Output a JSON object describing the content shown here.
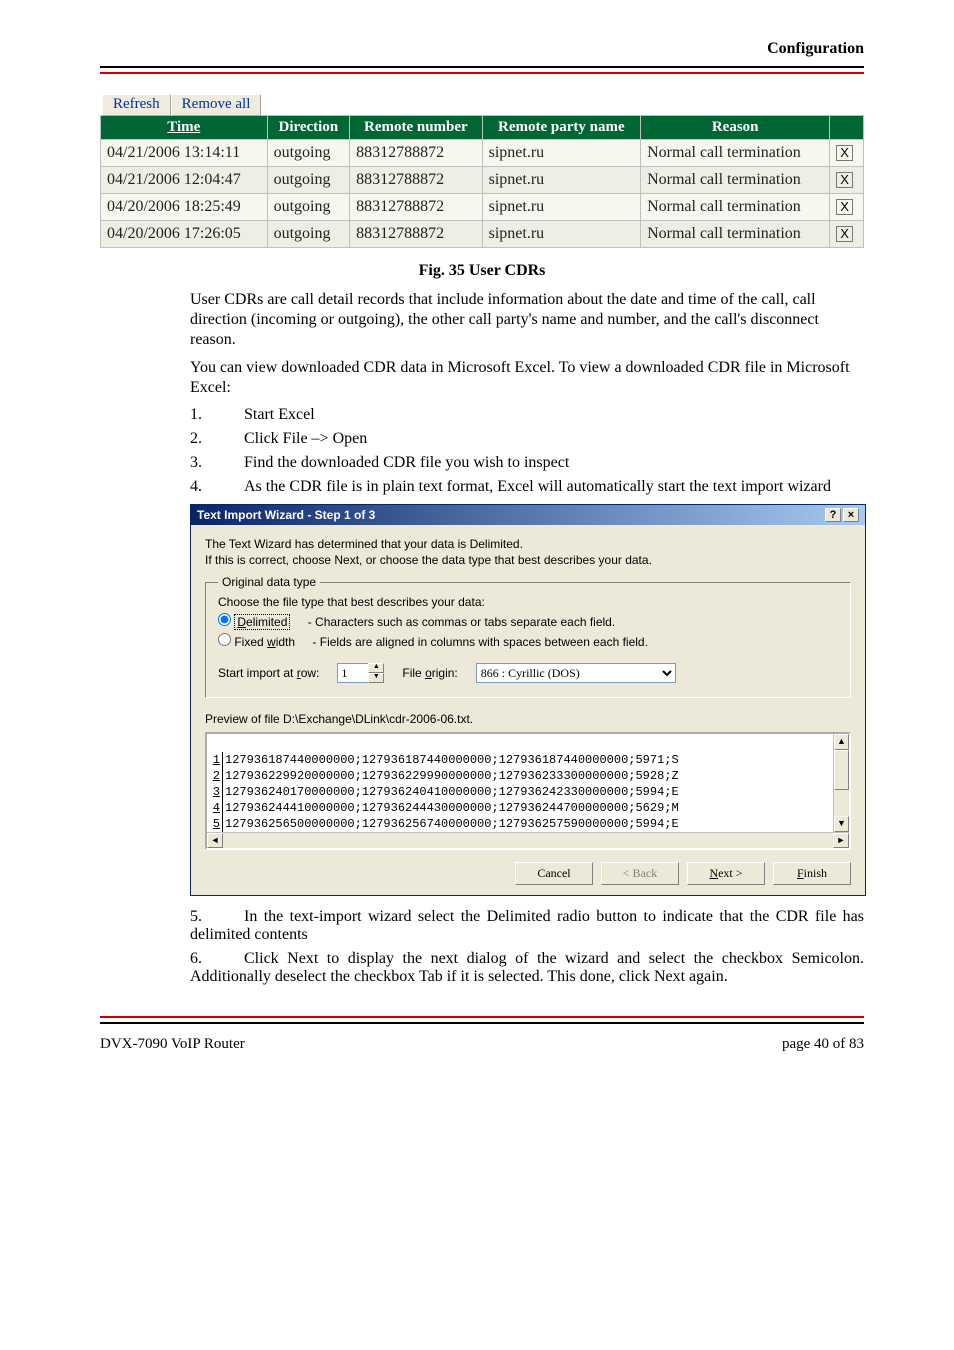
{
  "header": {
    "title": "Configuration"
  },
  "top_buttons": {
    "refresh": "Refresh",
    "remove_all": "Remove all"
  },
  "cdr_table": {
    "headers": [
      "Time",
      "Direction",
      "Remote number",
      "Remote party name",
      "Reason"
    ],
    "delete_label": "X",
    "rows": [
      {
        "time": "04/21/2006 13:14:11",
        "direction": "outgoing",
        "number": "88312788872",
        "name": "sipnet.ru",
        "reason": "Normal call termination"
      },
      {
        "time": "04/21/2006 12:04:47",
        "direction": "outgoing",
        "number": "88312788872",
        "name": "sipnet.ru",
        "reason": "Normal call termination"
      },
      {
        "time": "04/20/2006 18:25:49",
        "direction": "outgoing",
        "number": "88312788872",
        "name": "sipnet.ru",
        "reason": "Normal call termination"
      },
      {
        "time": "04/20/2006 17:26:05",
        "direction": "outgoing",
        "number": "88312788872",
        "name": "sipnet.ru",
        "reason": "Normal call termination"
      }
    ]
  },
  "fig_caption": "Fig. 35 User CDRs",
  "intro1": "User CDRs are call detail records that include information about the date and time of the call, call direction (incoming or outgoing), the other call party's name and number, and the call's disconnect reason.",
  "intro2": "You can view downloaded CDR data in Microsoft Excel. To view a downloaded CDR file in Microsoft Excel:",
  "steps": {
    "s1": {
      "num": "1.",
      "text": "Start Excel"
    },
    "s2": {
      "num": "2.",
      "text": "Click File –> Open"
    },
    "s3": {
      "num": "3.",
      "text": "Find the downloaded CDR file you wish to inspect"
    },
    "s4": {
      "num": "4.",
      "text": "As the CDR file is in plain text format, Excel will automatically start the text import wizard"
    }
  },
  "wizard": {
    "title": "Text Import Wizard - Step 1 of 3",
    "help_btn": "?",
    "close_btn": "×",
    "line1": "The Text Wizard has determined that your data is Delimited.",
    "line2": "If this is correct, choose Next, or choose the data type that best describes your data.",
    "group_legend": "Original data type",
    "group_prompt": "Choose the file type that best describes your data:",
    "radio_delimited": "Delimited",
    "radio_delimited_desc": "- Characters such as commas or tabs separate each field.",
    "radio_fixed": "Fixed width",
    "radio_fixed_desc": "- Fields are aligned in columns with spaces between each field.",
    "start_row_label": "Start import at row:",
    "start_row_value": "1",
    "file_origin_label": "File origin:",
    "file_origin_value": "866 : Cyrillic (DOS)",
    "preview_label": "Preview of file D:\\Exchange\\DLink\\cdr-2006-06.txt.",
    "preview_lines": [
      "127936187440000000;127936187440000000;127936187440000000;5971;S",
      "127936229920000000;127936229990000000;127936233300000000;5928;Z",
      "127936240170000000;127936240410000000;127936242330000000;5994;E",
      "127936244410000000;127936244430000000;127936244700000000;5629;M",
      "127936256500000000;127936256740000000;127936257590000000;5994;E"
    ],
    "buttons": {
      "cancel": "Cancel",
      "back": "< Back",
      "next": "Next >",
      "finish": "Finish"
    }
  },
  "step5": {
    "num": "5.",
    "text": "In the text-import wizard select the Delimited radio button to indicate that the CDR file has delimited contents"
  },
  "step6": {
    "num": "6.",
    "text": "Click Next to display the next dialog of the wizard and select the checkbox Semicolon. Additionally deselect the checkbox Tab if it is selected. This done, click Next again."
  },
  "footer": {
    "left": "DVX-7090 VoIP Router",
    "right": "page 40 of 83"
  }
}
